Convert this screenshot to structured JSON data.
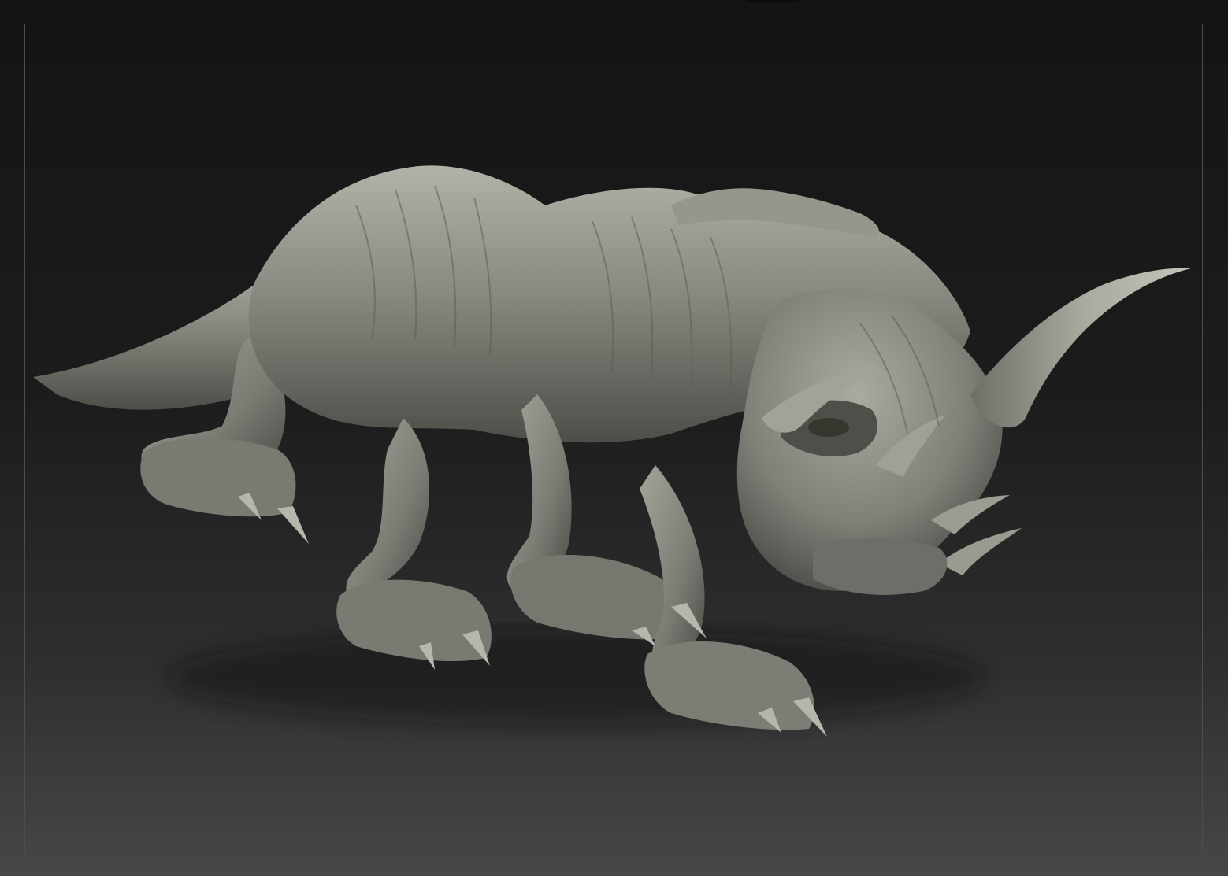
{
  "viewport": {
    "background_top_color": "#141414",
    "background_bottom_color": "#474747",
    "frame_border_color": "#4d4d4d"
  },
  "model": {
    "material_color": "#8a8a82",
    "shadow_color": "#3a3a36",
    "highlight_color": "#b8b8ae"
  }
}
